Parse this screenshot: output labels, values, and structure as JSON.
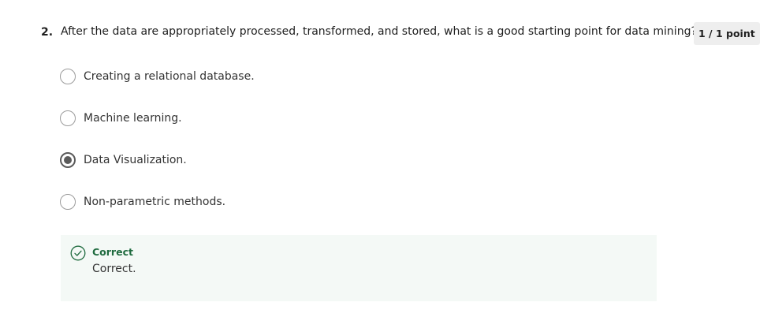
{
  "question": {
    "number": "2.",
    "text": "After the data are appropriately processed, transformed, and stored, what is a good starting point for data mining?",
    "score": "1 / 1 point"
  },
  "options": [
    {
      "label": "Creating a relational database.",
      "selected": false
    },
    {
      "label": "Machine learning.",
      "selected": false
    },
    {
      "label": "Data Visualization.",
      "selected": true
    },
    {
      "label": "Non-parametric methods.",
      "selected": false
    }
  ],
  "feedback": {
    "status": "Correct",
    "message": "Correct.",
    "icon": "check-circle-icon"
  },
  "colors": {
    "correct_green": "#1f6b3f",
    "feedback_bg": "#f4f9f6",
    "badge_bg": "#eeeeee",
    "radio_selected": "#5b5b5b"
  }
}
